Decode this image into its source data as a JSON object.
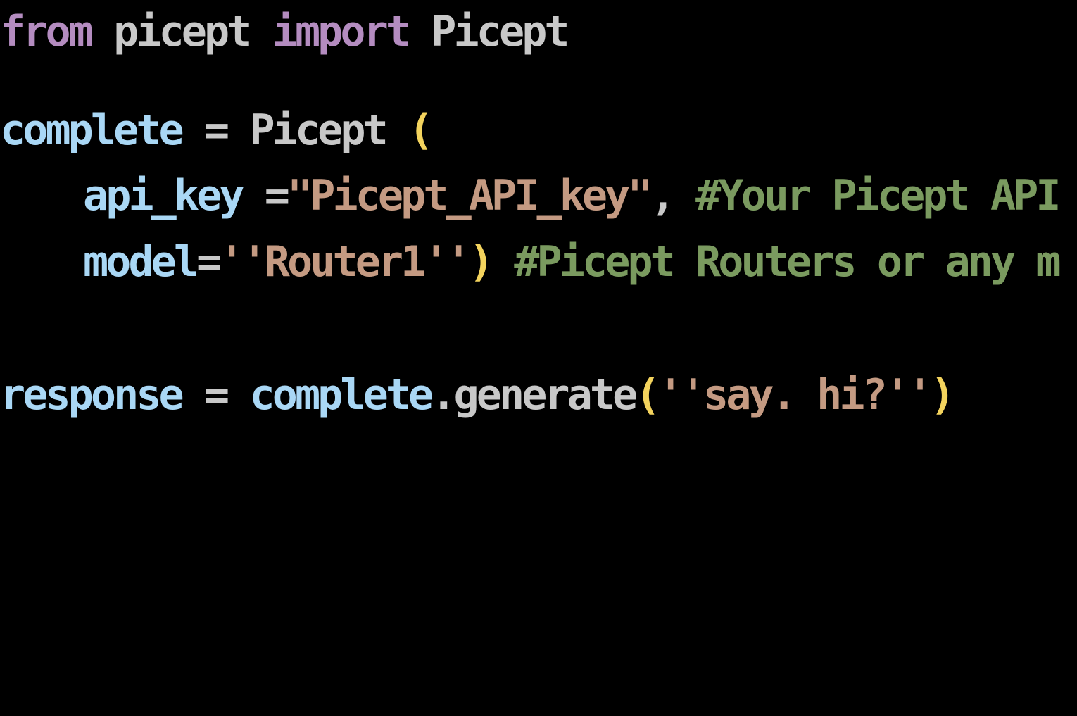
{
  "colors": {
    "background": "#000000",
    "keyword": "#b48cc0",
    "identifier": "#c8c8c8",
    "variable": "#a9d7f5",
    "paren": "#f3d35d",
    "string": "#c49a82",
    "comment": "#7a9a5f"
  },
  "code": {
    "line1": {
      "kw_from": "from",
      "module": "picept",
      "kw_import": "import",
      "class_name": "Picept"
    },
    "line2": {
      "var": "complete",
      "op": "=",
      "class_name": "Picept",
      "paren_open": "("
    },
    "line3": {
      "param": "api_key",
      "op": "=",
      "string": "\"Picept_API_key\"",
      "comma": ",",
      "comment": "#Your Picept API"
    },
    "line4": {
      "param": "model",
      "op": "=",
      "string": "''Router1''",
      "paren_close": ")",
      "comment": "#Picept Routers or any m"
    },
    "line5": {
      "var": "response",
      "op": "=",
      "object": "complete",
      "dot": ".",
      "method": "generate",
      "paren_open": "(",
      "string": "''say. hi?''",
      "paren_close": ")"
    }
  }
}
